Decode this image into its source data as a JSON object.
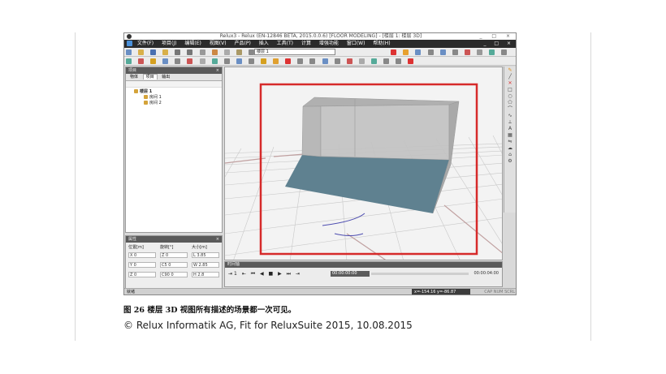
{
  "app": {
    "title": "Relux3 - Relux (EN-12846 BETA, 2015.0.0.6) [FLOOR MODELING] - [楼层 1: 楼层 3D]",
    "window_controls": "_ □ ×",
    "menu": [
      "文件(F)",
      "项目(J)",
      "编辑(E)",
      "视图(V)",
      "产品(P)",
      "插入",
      "工具(T)",
      "计算",
      "增强功能",
      "窗口(W)",
      "帮助(H)"
    ],
    "mdi_controls": "_ □ ×",
    "floor_select": "楼层 1",
    "colors": {
      "accent": "#d62a2a",
      "floor": "#5f8190",
      "walls": "#a8a8a8"
    }
  },
  "project_panel": {
    "title": "项目",
    "close": "×",
    "tabs": [
      "物体",
      "项目",
      "输出"
    ],
    "active_tab": "项目",
    "tree": [
      {
        "level": 1,
        "label": "楼层 1"
      },
      {
        "level": 2,
        "label": "房间 1"
      },
      {
        "level": 2,
        "label": "房间 2"
      }
    ]
  },
  "properties_panel": {
    "title": "属性",
    "close": "×",
    "headers": {
      "position": "位置[m]",
      "rotation": "旋转[°]",
      "size": "大小[m]"
    },
    "position": {
      "x": "X  0",
      "y": "Y  0",
      "z": "Z  0"
    },
    "rotation": {
      "z": "Z  0",
      "c5": "C5  0",
      "c90": "C90  0"
    },
    "size": {
      "l": "L  3.85",
      "w": "W  2.85",
      "h": "H  2.8"
    }
  },
  "timeline": {
    "title": "时间轴",
    "controls": "⇤  ⏮ ◀ ■ ▶ ⏭ ⇥",
    "loop": "⇥1",
    "time_start": "00:00:00:00",
    "time_end": "00:00:04:00"
  },
  "statusbar": {
    "ready": "就绪",
    "coords": "x=-154.16 y=-86.87",
    "caps": "CAP NUM SCRL"
  },
  "document": {
    "caption": "图 26 楼层 3D 视图所有描述的场景都一次可见。",
    "copyright": "© Relux Informatik AG, Fit for ReluxSuite 2015, 10.08.2015"
  }
}
